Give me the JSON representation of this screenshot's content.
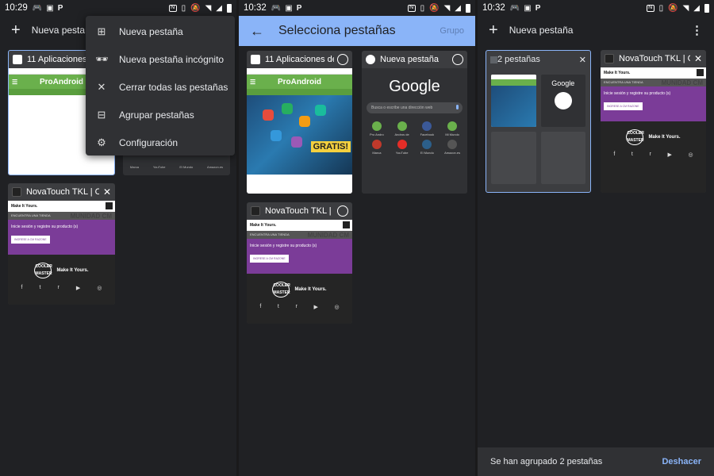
{
  "screen1": {
    "status": {
      "time": "10:29",
      "left_icons": [
        "gamepad",
        "image-icon",
        "p-icon"
      ],
      "right_icons": [
        "nfc",
        "vibrate",
        "bell-off",
        "wifi",
        "signal",
        "battery"
      ]
    },
    "toolbar": {
      "title": "Nueva pestaña"
    },
    "menu": [
      {
        "label": "Nueva pestaña",
        "icon": "plus-box-icon"
      },
      {
        "label": "Nueva pestaña incógnito",
        "icon": "incognito-icon"
      },
      {
        "label": "Cerrar todas las pestañas",
        "icon": "close-icon"
      },
      {
        "label": "Agrupar pestañas",
        "icon": "group-icon"
      },
      {
        "label": "Configuración",
        "icon": "gear-icon"
      }
    ],
    "tab1": {
      "title": "11 Aplicaciones",
      "brand": "ProAndroid"
    },
    "tab2": {
      "title": "NovaTouch TKL | C"
    },
    "google_labels": [
      "Marca",
      "YouTube",
      "El Mundo",
      "Amazon.es"
    ]
  },
  "screen2": {
    "status": {
      "time": "10:32"
    },
    "toolbar": {
      "title": "Selecciona pestañas",
      "action": "Grupo"
    },
    "tab1": {
      "title": "11 Aplicaciones de",
      "brand": "ProAndroid",
      "badge": "GRATIS!"
    },
    "tab2": {
      "title": "Nueva pestaña",
      "logo": "Google",
      "search_placeholder": "Busca o escribe una dirección web",
      "shortcuts": [
        "Pro Andro",
        "Andros de",
        "Facebook",
        "Mi Mundo",
        "Marca",
        "YouTube",
        "El Mundo",
        "Amazon.es"
      ]
    },
    "tab3": {
      "title": "NovaTouch TKL | C"
    }
  },
  "screen3": {
    "status": {
      "time": "10:32"
    },
    "toolbar": {
      "title": "Nueva pestaña"
    },
    "group": {
      "title": "2 pestañas"
    },
    "tab": {
      "title": "NovaTouch TKL | C"
    },
    "snackbar": {
      "message": "Se han agrupado 2 pestañas",
      "action": "Deshacer"
    }
  },
  "novatouch": {
    "brand": "Make It Yours.",
    "bar": "ENCUENTRA UNA TIENDA",
    "overlay": "MUNIDAD CM",
    "promo": "Inicie sesión y registre su producto (s)",
    "button": "INGRESE A CM RAZONE",
    "logo": "COOLER MASTER"
  },
  "colors": {
    "accent": "#8ab4f8",
    "proandroid_green": "#6ab04c",
    "cm_purple": "#7b3c98"
  }
}
